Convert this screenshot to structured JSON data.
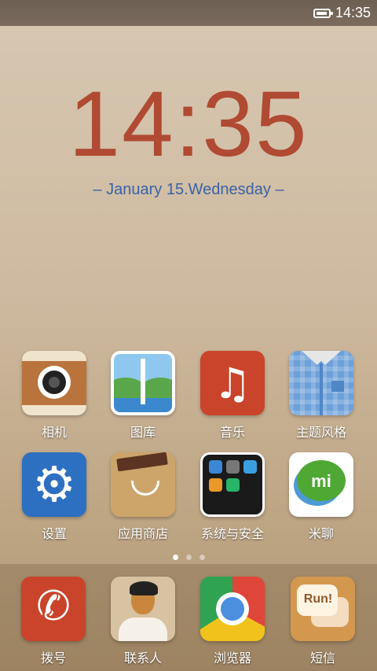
{
  "status_bar": {
    "time": "14:35",
    "battery_level": 0.9,
    "battery_icon": "battery-icon"
  },
  "lockclock": {
    "time": "14:35",
    "date": "– January 15.Wednesday –"
  },
  "apps_row1": [
    {
      "label": "相机",
      "icon": "camera-icon"
    },
    {
      "label": "图库",
      "icon": "gallery-icon"
    },
    {
      "label": "音乐",
      "icon": "music-icon"
    },
    {
      "label": "主题风格",
      "icon": "theme-icon"
    }
  ],
  "apps_row2": [
    {
      "label": "设置",
      "icon": "settings-icon"
    },
    {
      "label": "应用商店",
      "icon": "app-store-icon"
    },
    {
      "label": "系统与安全",
      "icon": "security-folder-icon"
    },
    {
      "label": "米聊",
      "icon": "mi-chat-icon"
    }
  ],
  "page_indicator": {
    "count": 3,
    "active": 0
  },
  "dock": [
    {
      "label": "拨号",
      "icon": "phone-icon"
    },
    {
      "label": "联系人",
      "icon": "contacts-icon"
    },
    {
      "label": "浏览器",
      "icon": "browser-icon"
    },
    {
      "label": "短信",
      "icon": "messages-icon"
    }
  ],
  "icon_glyphs": {
    "music": "♫",
    "settings": "⚙",
    "phone": "✆",
    "mi": "mi",
    "run": "Run!"
  }
}
